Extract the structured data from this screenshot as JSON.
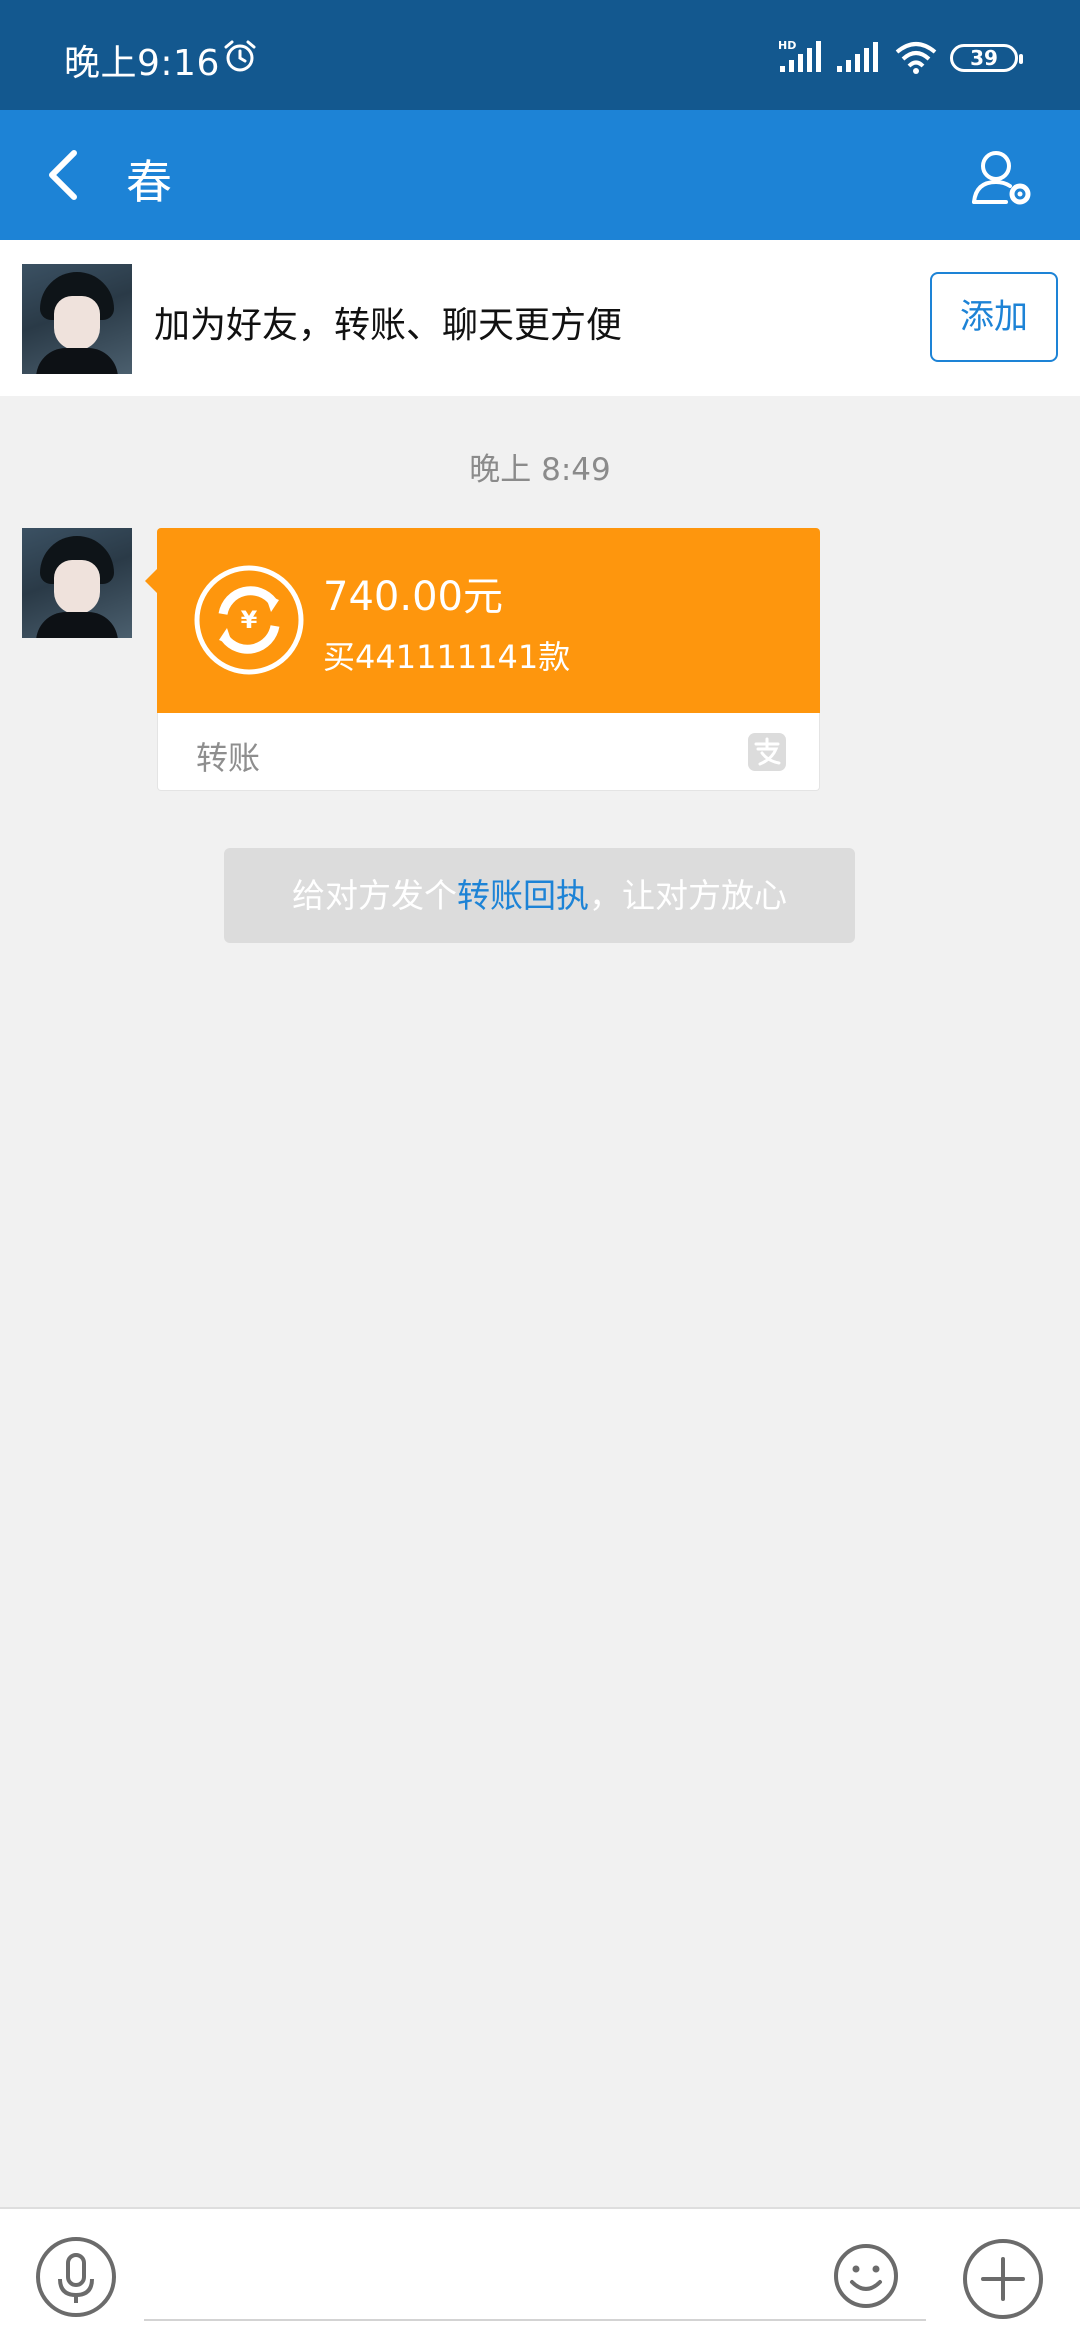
{
  "status_bar": {
    "time": "晚上9:16",
    "battery": "39",
    "signal_label": "HD",
    "icons": [
      "alarm-icon",
      "hd-signal-icon",
      "signal-icon",
      "wifi-icon",
      "battery-icon"
    ]
  },
  "header": {
    "title": "春",
    "back_icon": "chevron-left-icon",
    "settings_icon": "user-settings-icon"
  },
  "add_friend": {
    "text": "加为好友，转账、聊天更方便",
    "button_label": "添加"
  },
  "chat": {
    "timestamp": "晚上 8:49",
    "transfer": {
      "amount": "740.00元",
      "memo": "买441111141款",
      "label": "转账",
      "icon": "transfer-yuan-icon",
      "brand_icon": "alipay-icon"
    },
    "receipt_tip": {
      "prefix": "给对方发个",
      "link": "转账回执",
      "suffix": "，让对方放心"
    }
  },
  "input_bar": {
    "icons": [
      "microphone-icon",
      "emoji-icon",
      "plus-icon"
    ]
  },
  "colors": {
    "status_bar": "#13588f",
    "header": "#1d83d6",
    "transfer_orange": "#fe960d",
    "background": "#f1f1f1",
    "link_blue": "#1d83d6"
  }
}
